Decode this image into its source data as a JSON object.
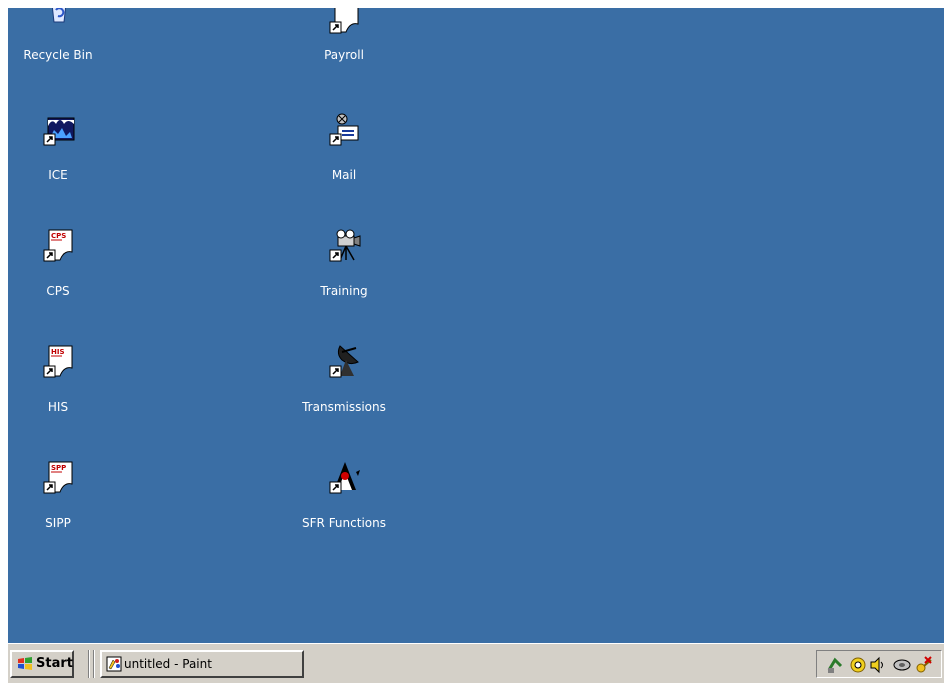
{
  "desktop": {
    "background": "#3a6ea5",
    "icons": [
      {
        "label": "Recycle Bin",
        "icon": "recycle-bin-icon"
      },
      {
        "label": "ICE",
        "icon": "ice-icon"
      },
      {
        "label": "CPS",
        "icon": "document-shortcut-icon",
        "badge": "CPS"
      },
      {
        "label": "HIS",
        "icon": "document-shortcut-icon",
        "badge": "HIS"
      },
      {
        "label": "SIPP",
        "icon": "document-shortcut-icon",
        "badge": "SPP"
      },
      {
        "label": "Payroll",
        "icon": "document-shortcut-icon"
      },
      {
        "label": "Mail",
        "icon": "mail-icon"
      },
      {
        "label": "Training",
        "icon": "video-camera-icon"
      },
      {
        "label": "Transmissions",
        "icon": "satellite-dish-icon"
      },
      {
        "label": "SFR Functions",
        "icon": "java-duke-icon"
      }
    ]
  },
  "taskbar": {
    "start_label": "Start",
    "tasks": [
      {
        "label": "untitled - Paint",
        "icon": "paint-icon"
      }
    ],
    "tray_icons": [
      "network-icon",
      "tv-tuner-icon",
      "volume-icon",
      "disk-icon",
      "key-error-icon"
    ]
  }
}
